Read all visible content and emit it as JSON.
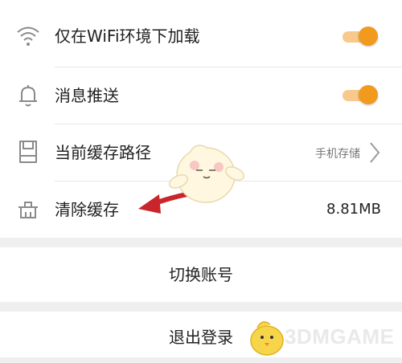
{
  "settings": {
    "items": [
      {
        "label": "仅在WiFi环境下加载",
        "icon": "wifi-icon",
        "toggle_on": true
      },
      {
        "label": "消息推送",
        "icon": "bell-icon",
        "toggle_on": true
      },
      {
        "label": "当前缓存路径",
        "icon": "sd-card-icon",
        "value": "手机存储"
      },
      {
        "label": "清除缓存",
        "icon": "broom-icon",
        "value": "8.81MB"
      }
    ]
  },
  "actions": {
    "switch_account": "切换账号",
    "logout": "退出登录"
  },
  "watermark": {
    "text": "3DMGAME"
  },
  "colors": {
    "accent": "#f29a1e",
    "arrow": "#c8262a"
  }
}
